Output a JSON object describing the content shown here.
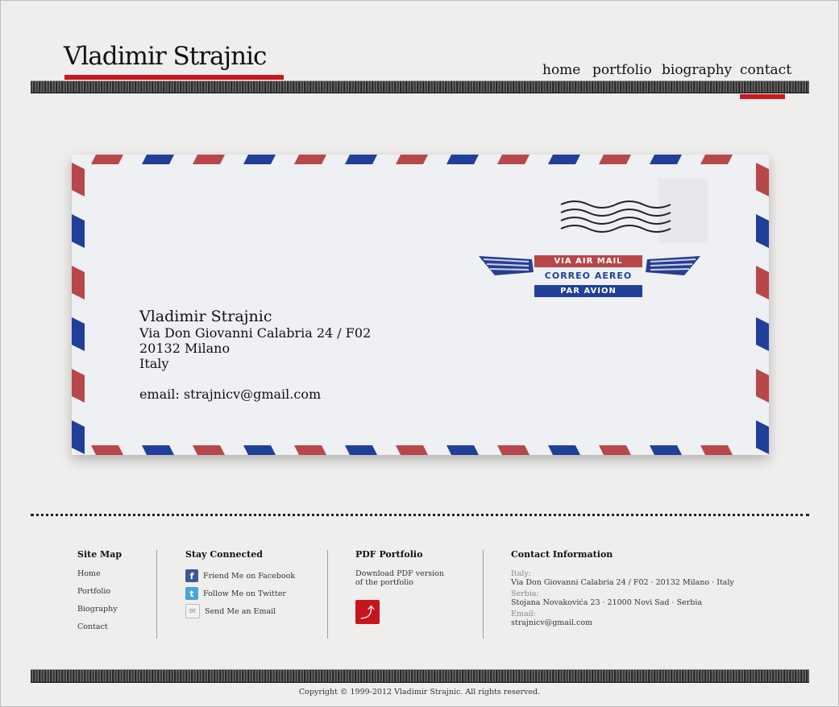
{
  "header": {
    "site_title": "Vladimir Strajnic",
    "nav": [
      "home",
      "portfolio",
      "biography",
      "contact"
    ],
    "active_nav": "contact",
    "accent_color": "#c8191d"
  },
  "envelope": {
    "airmail_badge": {
      "top": "VIA AIR MAIL",
      "middle": "CORREO AEREO",
      "bottom": "PAR AVION"
    },
    "address": {
      "name": "Vladimir Strajnic",
      "street": "Via Don Giovanni Calabria 24 / F02",
      "city": "20132 Milano",
      "country": "Italy",
      "email": "email: strajnicv@gmail.com"
    }
  },
  "footer": {
    "site_map": {
      "heading": "Site Map",
      "links": [
        "Home",
        "Portfolio",
        "Biography",
        "Contact"
      ]
    },
    "stay_connected": {
      "heading": "Stay Connected",
      "items": [
        {
          "label": "Friend Me on Facebook",
          "icon": "facebook-icon"
        },
        {
          "label": "Follow Me on Twitter",
          "icon": "twitter-icon"
        },
        {
          "label": "Send Me an Email",
          "icon": "email-icon"
        }
      ]
    },
    "pdf_portfolio": {
      "heading": "PDF Portfolio",
      "line1": "Download PDF version",
      "line2": "of the portfolio",
      "icon": "pdf-icon"
    },
    "contact_information": {
      "heading": "Contact Information",
      "italy_label": "Italy:",
      "italy_value": "Via Don Giovanni Calabria 24 / F02  ·  20132 Milano  ·  Italy",
      "serbia_label": "Serbia:",
      "serbia_value": "Stojana Novakovića 23  ·  21000 Novi Sad  ·  Serbia",
      "email_label": "Email:",
      "email_value": "strajnicv@gmail.com"
    },
    "copyright": "Copyright © 1999-2012 Vladimir Strajnic. All rights reserved."
  }
}
